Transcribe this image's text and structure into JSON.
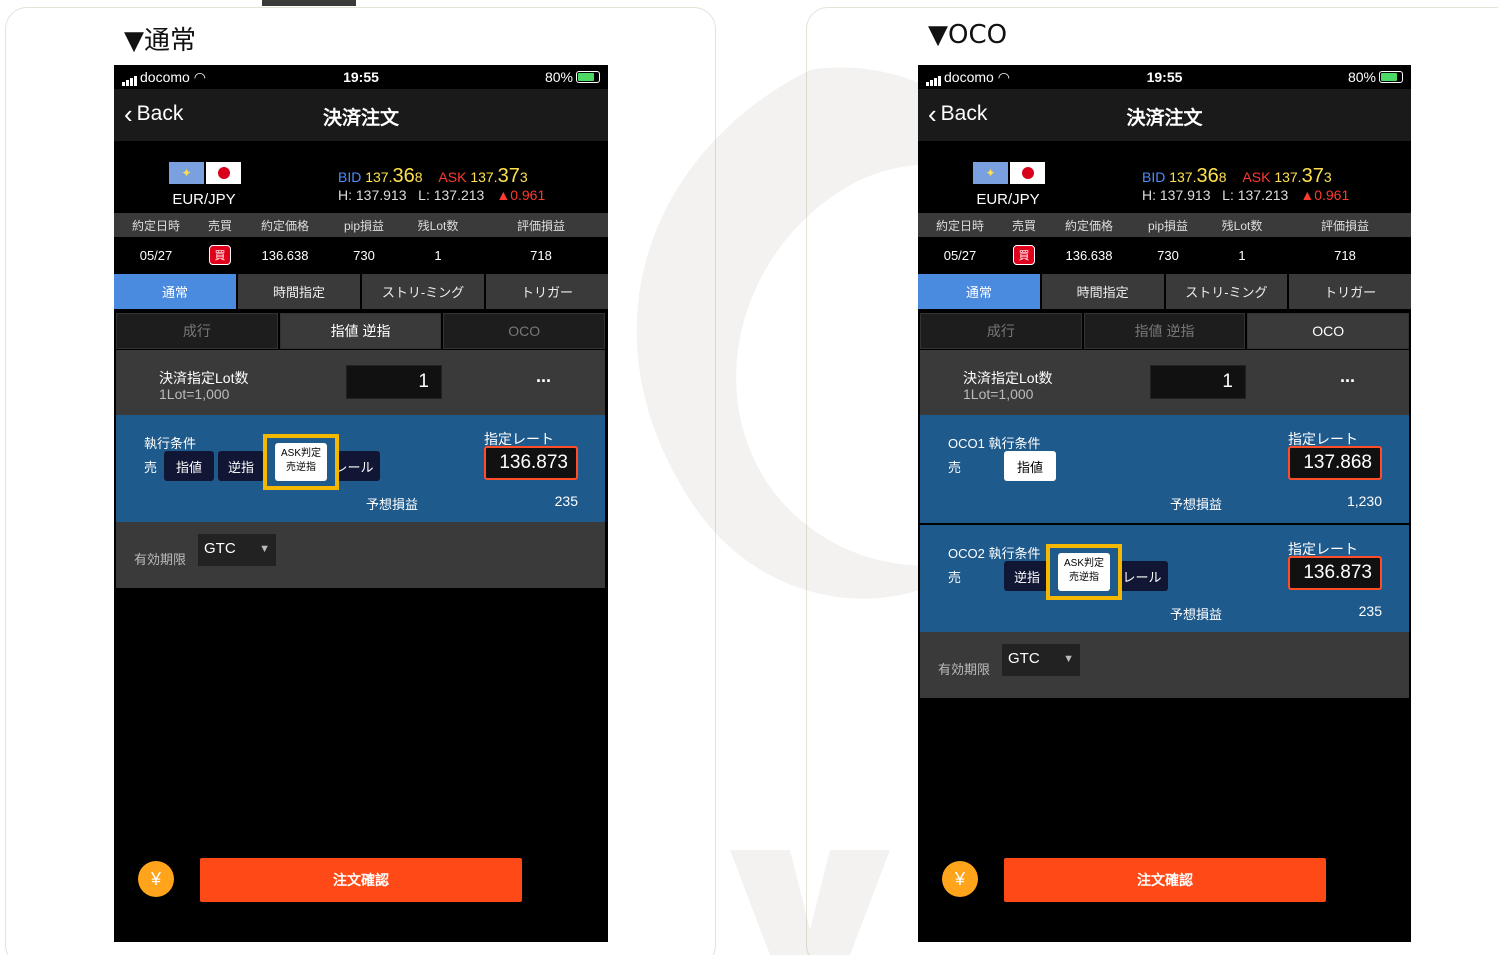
{
  "left": {
    "section_title": "▼通常",
    "status": {
      "carrier": "docomo",
      "time": "19:55",
      "battery": "80%"
    },
    "nav": {
      "back": "Back",
      "title": "決済注文"
    },
    "pair": {
      "name": "EUR/JPY",
      "bid_label": "BID",
      "bid_main": "137.",
      "bid_big": "36",
      "bid_last": "8",
      "ask_label": "ASK",
      "ask_main": "137.",
      "ask_big": "37",
      "ask_last": "3",
      "high": "H: 137.913",
      "low": "L: 137.213",
      "change": "▲0.961"
    },
    "position": {
      "headers": [
        "約定日時",
        "売買",
        "約定価格",
        "pip損益",
        "残Lot数",
        "評価損益"
      ],
      "date": "05/27",
      "side": "買",
      "price": "136.638",
      "pips": "730",
      "lots": "1",
      "pl": "718"
    },
    "type_tabs": [
      "通常",
      "時間指定",
      "ストリ-ミング",
      "トリガー"
    ],
    "order_tabs": [
      "成行",
      "指値 逆指",
      "OCO"
    ],
    "lot": {
      "label": "決済指定Lot数",
      "sub": "1Lot=1,000",
      "value": "1",
      "more": "..."
    },
    "exec": {
      "label": "執行条件",
      "sell": "売",
      "btn_limit": "指値",
      "btn_stop": "逆指",
      "btn_trail": "レール",
      "popup_l1": "ASK判定",
      "popup_l2": "売逆指",
      "rate_label": "指定レート",
      "rate": "136.873",
      "profit_label": "予想損益",
      "profit": "235"
    },
    "expiry": {
      "label": "有効期限",
      "value": "GTC"
    },
    "confirm": "注文確認",
    "coin": "¥"
  },
  "right": {
    "section_title": "▼OCO",
    "status": {
      "carrier": "docomo",
      "time": "19:55",
      "battery": "80%"
    },
    "nav": {
      "back": "Back",
      "title": "決済注文"
    },
    "pair": {
      "name": "EUR/JPY",
      "bid_label": "BID",
      "bid_main": "137.",
      "bid_big": "36",
      "bid_last": "8",
      "ask_label": "ASK",
      "ask_main": "137.",
      "ask_big": "37",
      "ask_last": "3",
      "high": "H: 137.913",
      "low": "L: 137.213",
      "change": "▲0.961"
    },
    "position": {
      "headers": [
        "約定日時",
        "売買",
        "約定価格",
        "pip損益",
        "残Lot数",
        "評価損益"
      ],
      "date": "05/27",
      "side": "買",
      "price": "136.638",
      "pips": "730",
      "lots": "1",
      "pl": "718"
    },
    "type_tabs": [
      "通常",
      "時間指定",
      "ストリ-ミング",
      "トリガー"
    ],
    "order_tabs": [
      "成行",
      "指値 逆指",
      "OCO"
    ],
    "lot": {
      "label": "決済指定Lot数",
      "sub": "1Lot=1,000",
      "value": "1",
      "more": "..."
    },
    "oco1": {
      "label": "OCO1 執行条件",
      "sell": "売",
      "btn_limit": "指値",
      "rate_label": "指定レート",
      "rate": "137.868",
      "profit_label": "予想損益",
      "profit": "1,230"
    },
    "oco2": {
      "label": "OCO2 執行条件",
      "sell": "売",
      "btn_stop": "逆指",
      "btn_trail": "レール",
      "popup_l1": "ASK判定",
      "popup_l2": "売逆指",
      "rate_label": "指定レート",
      "rate": "136.873",
      "profit_label": "予想損益",
      "profit": "235"
    },
    "expiry": {
      "label": "有効期限",
      "value": "GTC"
    },
    "confirm": "注文確認",
    "coin": "¥"
  },
  "colors": {
    "accent_tab": "#4a8be0",
    "confirm": "#ff4a17",
    "highlight": "#f5b800",
    "exec_panel": "#1f5a8c"
  }
}
